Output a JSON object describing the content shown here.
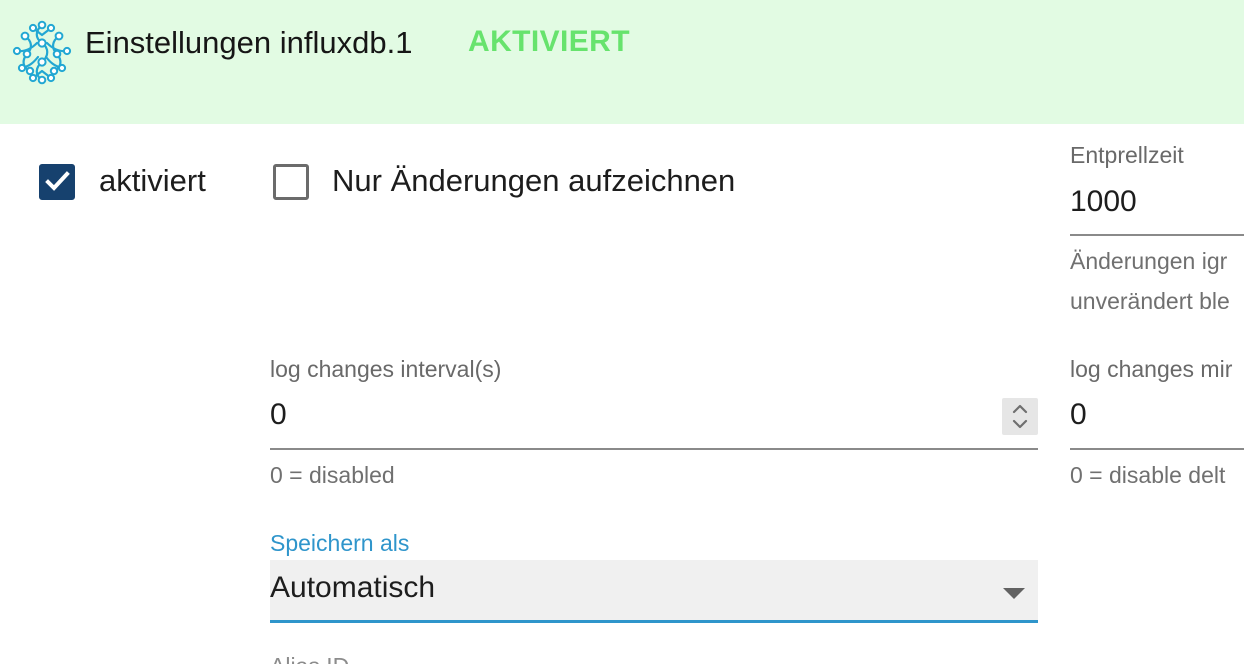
{
  "header": {
    "title": "Einstellungen influxdb.1",
    "status": "AKTIVIERT",
    "logo_icon": "network-node-logo-icon"
  },
  "checkboxes": {
    "enabled": {
      "label": "aktiviert",
      "checked": true
    },
    "changes_only": {
      "label": "Nur Änderungen aufzeichnen",
      "checked": false
    }
  },
  "debounce": {
    "label": "Entprellzeit",
    "value": "1000",
    "helper_line1": "Änderungen igr",
    "helper_line2": "unverändert ble"
  },
  "log_changes_interval": {
    "label": "log changes interval(s)",
    "value": "0",
    "helper": "0 = disabled"
  },
  "log_changes_min": {
    "label": "log changes mir",
    "value": "0",
    "helper": "0 = disable delt"
  },
  "save_as": {
    "label": "Speichern als",
    "value": "Automatisch"
  },
  "partial_next_label": "Alias ID",
  "colors": {
    "header_background": "#e2fbe3",
    "status": "#67e36d",
    "checkbox_checked": "#16416e",
    "select_accent": "#2f95cb",
    "logo": "#22a7d3"
  }
}
